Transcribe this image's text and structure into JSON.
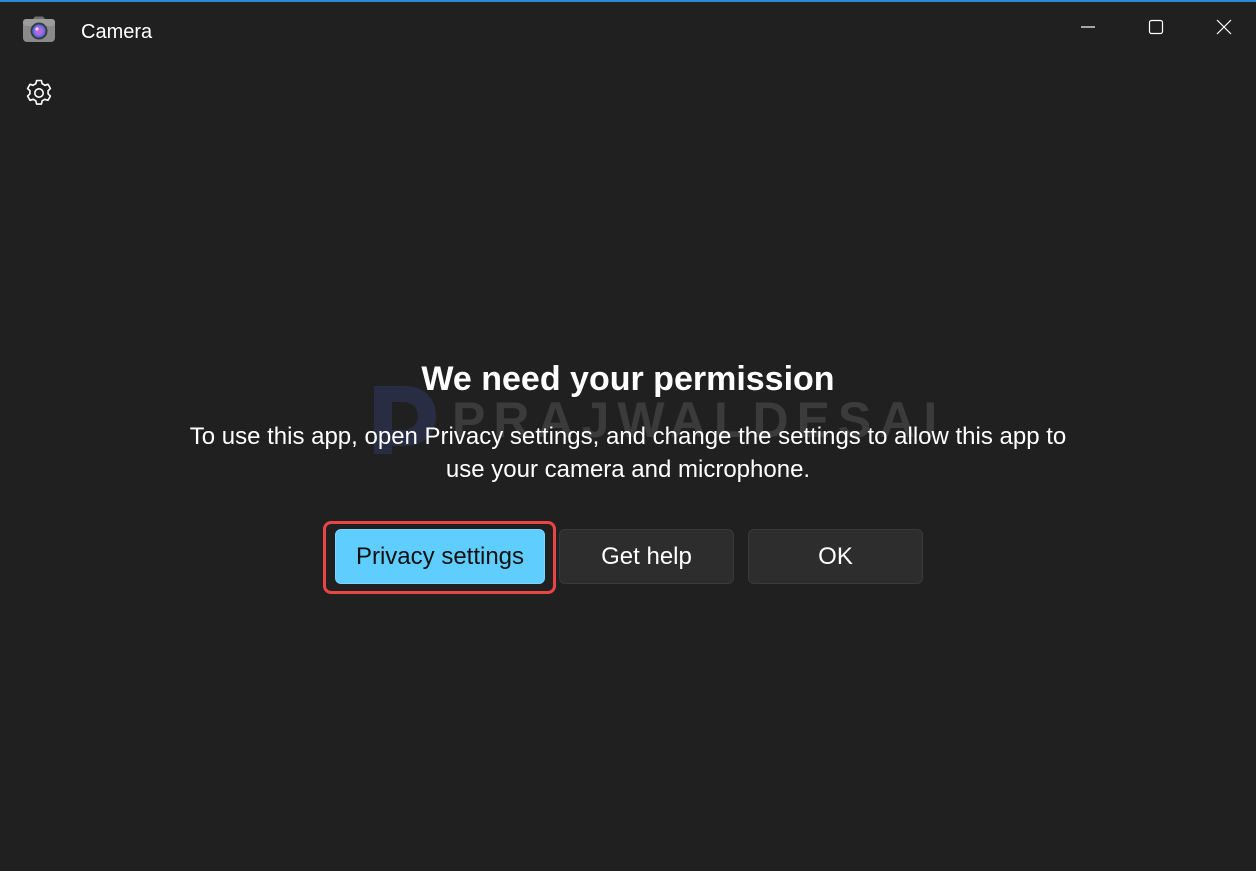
{
  "window": {
    "title": "Camera",
    "accent_color": "#2b88d8"
  },
  "titlebar": {
    "icons": [
      "camera-app-icon",
      "minimize-icon",
      "maximize-icon",
      "close-icon"
    ]
  },
  "toolbar": {
    "settings_icon": "gear-icon"
  },
  "dialog": {
    "heading": "We need your permission",
    "message": "To use this app, open Privacy settings, and change the settings to allow this app to use your camera and microphone.",
    "buttons": {
      "privacy_settings": "Privacy settings",
      "get_help": "Get help",
      "ok": "OK"
    },
    "primary_color": "#5fcdfd",
    "highlight_color": "#e84545"
  },
  "watermark": {
    "text": "PRAJWALDESAI"
  }
}
